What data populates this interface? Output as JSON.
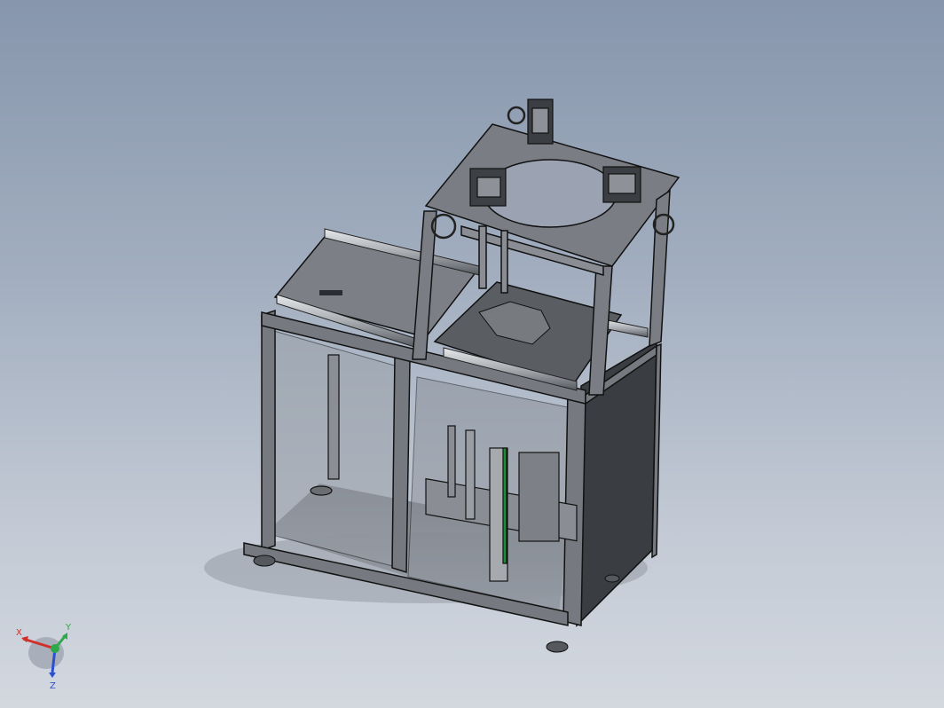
{
  "viewport": {
    "background_top": "#8796ad",
    "background_bottom": "#d3d8df",
    "model_color": "#6f7378",
    "edge_color": "#1a1c1f",
    "glass_color": "#9aa0a8"
  },
  "triad": {
    "x_label": "X",
    "y_label": "Y",
    "z_label": "Z",
    "x_color": "#d0302a",
    "y_color": "#2fa84a",
    "z_color": "#2a4fd0"
  }
}
